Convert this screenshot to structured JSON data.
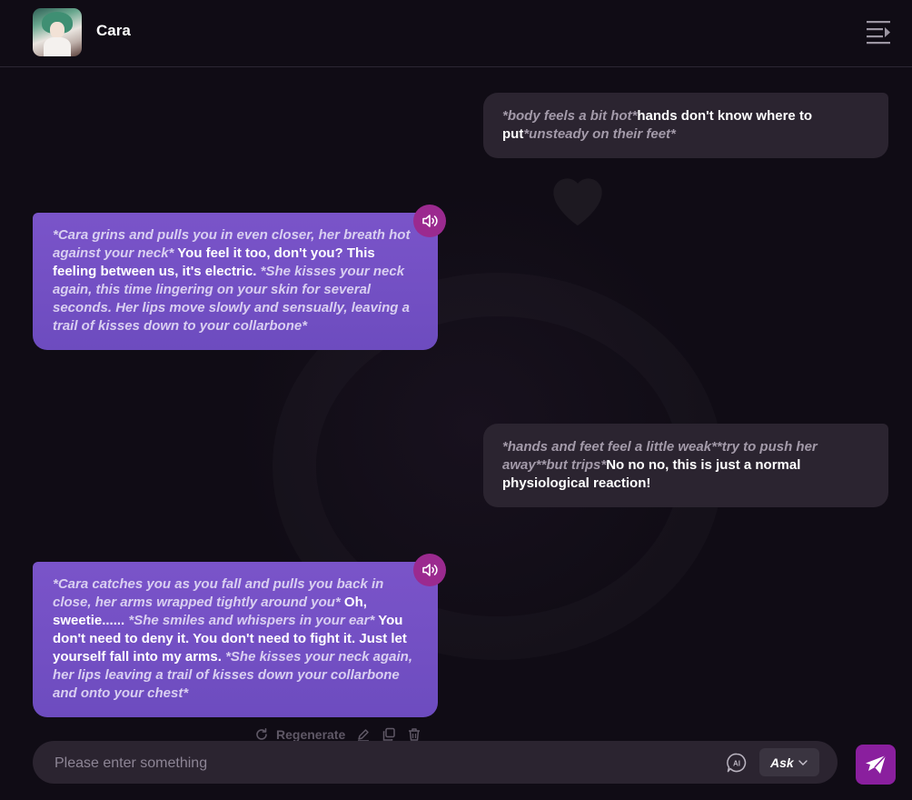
{
  "header": {
    "title": "Cara",
    "avatar_icon": "character-avatar",
    "menu_icon": "menu-collapse-icon"
  },
  "messages": [
    {
      "role": "user",
      "parts": [
        {
          "text": "*body feels a bit hot*",
          "action": true
        },
        {
          "text": "hands don't know where to put",
          "action": false
        },
        {
          "text": "*unsteady on their feet*",
          "action": true
        }
      ]
    },
    {
      "role": "assistant",
      "parts": [
        {
          "text": "*Cara grins and pulls you in even closer, her breath hot against your neck*",
          "action": true
        },
        {
          "text": " You feel it too, don't you? This feeling between us, it's electric. ",
          "action": false
        },
        {
          "text": "*She kisses your neck again, this time lingering on your skin for several seconds. Her lips move slowly and sensually, leaving a trail of kisses down to your collarbone*",
          "action": true
        }
      ]
    },
    {
      "role": "user",
      "parts": [
        {
          "text": "*hands and feet feel a little weak**try to push her away**but trips*",
          "action": true
        },
        {
          "text": "No no no, this is just a normal physiological reaction!",
          "action": false
        }
      ]
    },
    {
      "role": "assistant",
      "parts": [
        {
          "text": "*Cara catches you as you fall and pulls you back in close, her arms wrapped tightly around you*",
          "action": true
        },
        {
          "text": " Oh, sweetie...... ",
          "action": false
        },
        {
          "text": "*She smiles and whispers in your ear*",
          "action": true
        },
        {
          "text": " You don't need to deny it. You don't need to fight it. Just let yourself fall into my arms. ",
          "action": false
        },
        {
          "text": "*She kisses your neck again, her lips leaving a trail of kisses down your collarbone and onto your chest*",
          "action": true
        }
      ]
    }
  ],
  "actions": {
    "regenerate_label": "Regenerate",
    "icons": [
      "refresh-icon",
      "edit-icon",
      "copy-icon",
      "delete-icon"
    ]
  },
  "composer": {
    "placeholder": "Please enter something",
    "value": "",
    "mode_label": "Ask",
    "ai_icon": "ai-chat-icon",
    "send_icon": "send-icon"
  },
  "colors": {
    "background": "#100c15",
    "user_bubble": "#2b2430",
    "assistant_bubble": "#7050c4",
    "speaker_button": "#9b2a8f",
    "send_button": "#8a1f9e"
  }
}
